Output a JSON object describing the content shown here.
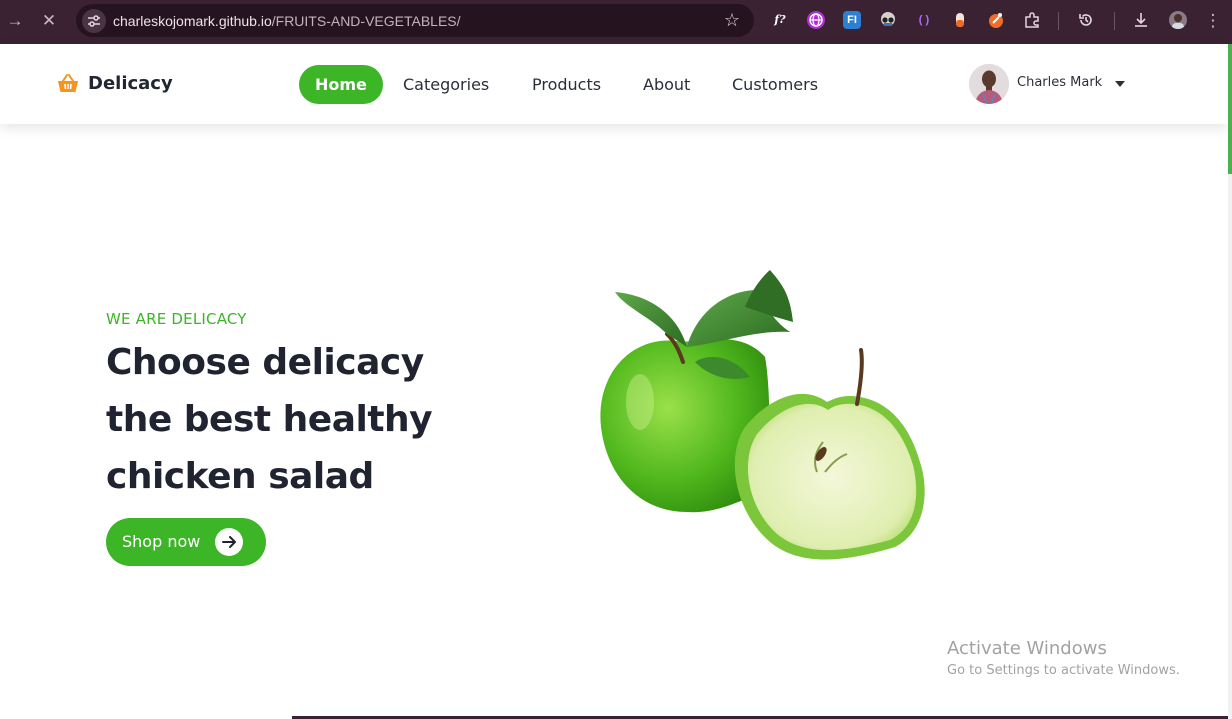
{
  "browser": {
    "url_host": "charleskojomark.github.io",
    "url_path": "/FRUITS-AND-VEGETABLES/",
    "extensions": [
      "function-icon",
      "globe-extension-icon",
      "fi-extension-icon",
      "glasses-extension-icon",
      "brackets-extension-icon",
      "capsule-extension-icon",
      "hand-extension-icon",
      "puzzle-icon"
    ]
  },
  "header": {
    "brand": "Delicacy",
    "nav": [
      {
        "label": "Home",
        "active": true
      },
      {
        "label": "Categories"
      },
      {
        "label": "Products"
      },
      {
        "label": "About"
      },
      {
        "label": "Customers"
      }
    ],
    "user_name": "Charles Mark"
  },
  "hero": {
    "eyebrow": "WE ARE DELICACY",
    "headline": [
      "Choose delicacy",
      "the best healthy",
      "chicken salad"
    ],
    "cta": "Shop now"
  },
  "watermark": {
    "title": "Activate Windows",
    "subtitle": "Go to Settings to activate Windows."
  },
  "colors": {
    "accent": "#3cb527",
    "chrome": "#3b2233",
    "heading": "#1f2430",
    "logo": "#f7941d"
  }
}
